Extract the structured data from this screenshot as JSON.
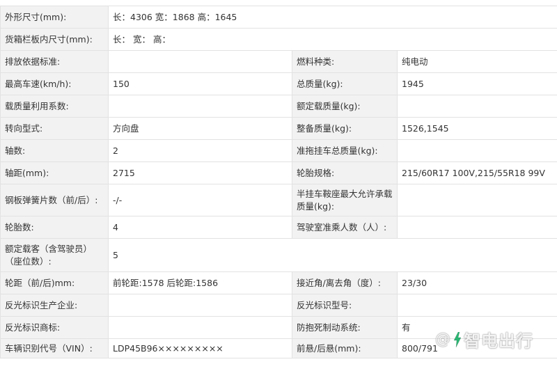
{
  "rows": [
    {
      "l1": "外形尺寸(mm):",
      "v1": "长：4306 宽：1868 高：1645"
    },
    {
      "l1": "货箱栏板内尺寸(mm):",
      "v1": "长：  宽：  高："
    },
    {
      "l1": "排放依据标准:",
      "v1": "",
      "l2": "燃料种类:",
      "v2": "纯电动"
    },
    {
      "l1": "最高车速(km/h):",
      "v1": "150",
      "l2": "总质量(kg):",
      "v2": "1945"
    },
    {
      "l1": "载质量利用系数:",
      "v1": "",
      "l2": "额定载质量(kg):",
      "v2": ""
    },
    {
      "l1": "转向型式:",
      "v1": "方向盘",
      "l2": "整备质量(kg):",
      "v2": "1526,1545"
    },
    {
      "l1": "轴数:",
      "v1": "2",
      "l2": "准拖挂车总质量(kg):",
      "v2": ""
    },
    {
      "l1": "轴距(mm):",
      "v1": "2715",
      "l2": "轮胎规格:",
      "v2": "215/60R17 100V,215/55R18 99V"
    },
    {
      "l1": "钢板弹簧片数（前/后）:",
      "v1": "-/-",
      "l2": "半挂车鞍座最大允许承载质量(kg):",
      "v2": ""
    },
    {
      "l1": "轮胎数:",
      "v1": "4",
      "l2": "驾驶室准乘人数（人）:",
      "v2": ""
    },
    {
      "l1": "额定载客（含驾驶员）（座位数）:",
      "v1": "5"
    },
    {
      "l1": "轮距（前/后)mm:",
      "v1": "前轮距:1578 后轮距:1586",
      "l2": "接近角/离去角（度）:",
      "v2": "23/30"
    },
    {
      "l1": "反光标识生产企业:",
      "v1": "",
      "l2": "反光标识型号:",
      "v2": ""
    },
    {
      "l1": "反光标识商标:",
      "v1": "",
      "l2": "防抱死制动系统:",
      "v2": "有"
    },
    {
      "l1": "车辆识别代号（VIN）:",
      "v1": "LDP45B96×××××××××",
      "l2": "前悬/后悬(mm):",
      "v2": "800/791"
    }
  ],
  "watermark": {
    "at": "@",
    "text": "智电出行"
  }
}
